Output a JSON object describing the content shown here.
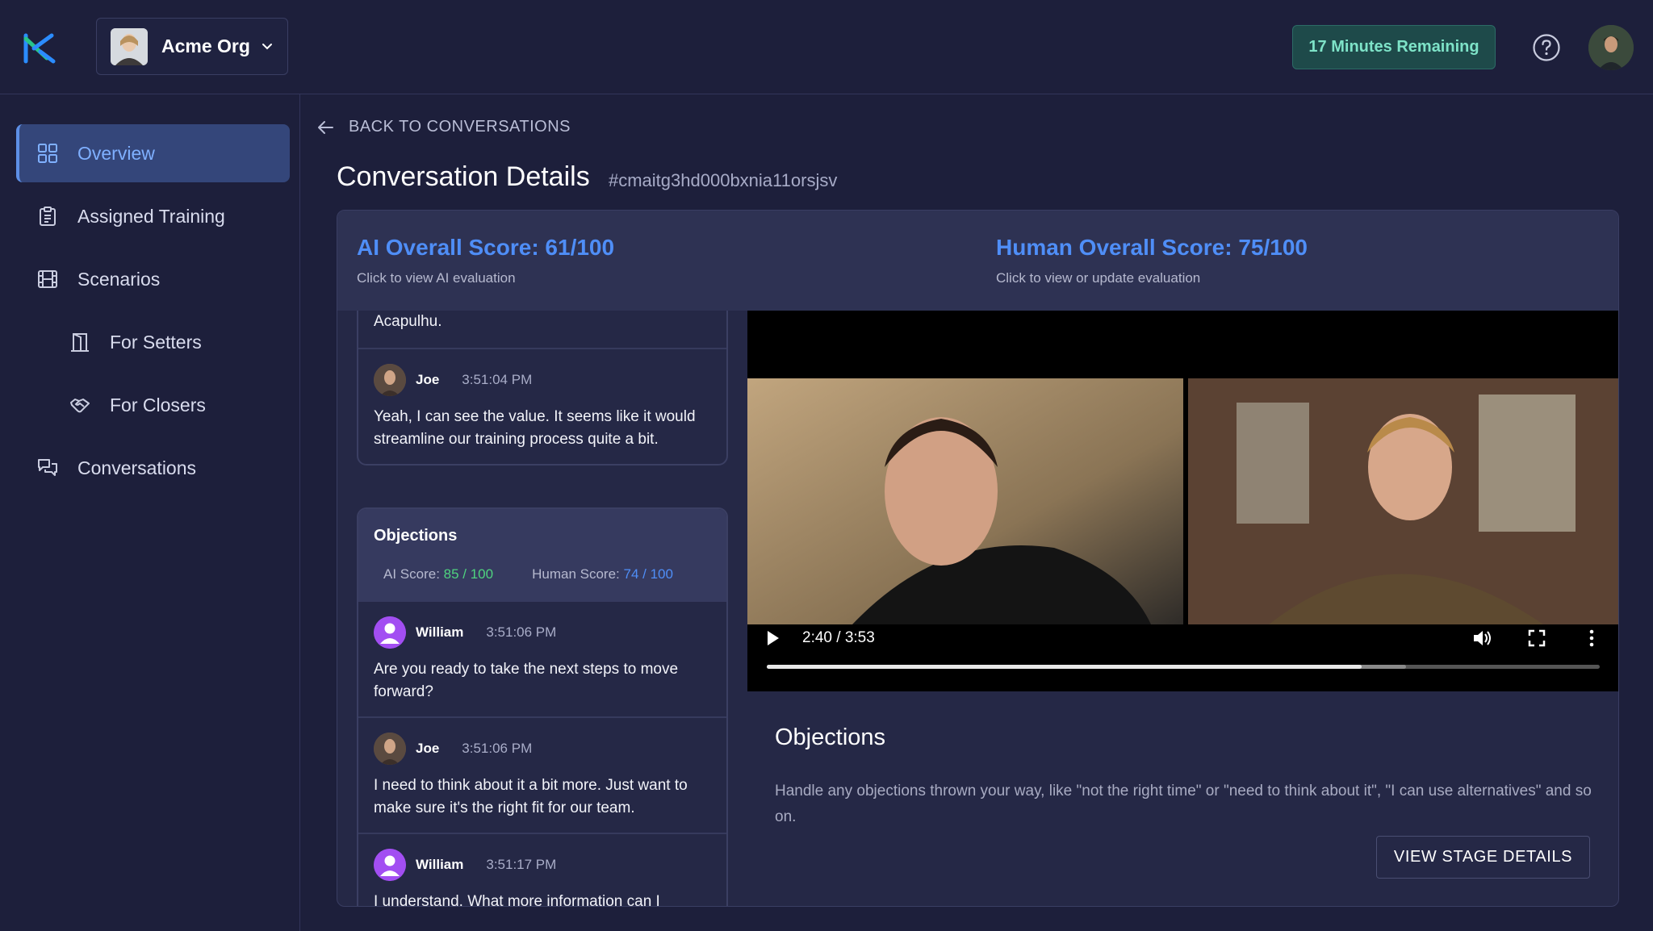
{
  "header": {
    "org_name": "Acme Org",
    "minutes_remaining": "17 Minutes Remaining"
  },
  "sidebar": {
    "items": [
      {
        "label": "Overview",
        "icon": "grid-icon",
        "active": true
      },
      {
        "label": "Assigned Training",
        "icon": "clipboard-icon"
      },
      {
        "label": "Scenarios",
        "icon": "film-icon"
      },
      {
        "label": "For Setters",
        "icon": "door-icon"
      },
      {
        "label": "For Closers",
        "icon": "handshake-icon"
      },
      {
        "label": "Conversations",
        "icon": "chat-bubbles-icon"
      }
    ]
  },
  "main": {
    "back_label": "BACK TO CONVERSATIONS",
    "title": "Conversation Details",
    "conversation_id": "#cmaitg3hd000bxnia11orsjsv",
    "ai_score_title": "AI Overall Score: 61/100",
    "ai_score_sub": "Click to view AI evaluation",
    "human_score_title": "Human Overall Score: 75/100",
    "human_score_sub": "Click to view or update evaluation"
  },
  "chat": {
    "truncated_text": "Acapulhu.",
    "msg1": {
      "name": "Joe",
      "time": "3:51:04 PM",
      "text": "Yeah, I can see the value. It seems like it would streamline our training process quite a bit."
    },
    "stage": {
      "title": "Objections",
      "ai_label": "AI Score: ",
      "ai_value": "85 / 100",
      "human_label": "Human Score: ",
      "human_value": "74 / 100"
    },
    "msg2": {
      "name": "William",
      "time": "3:51:06 PM",
      "text": "Are you ready to take the next steps to move forward?"
    },
    "msg3": {
      "name": "Joe",
      "time": "3:51:06 PM",
      "text": "I need to think about it a bit more. Just want to make sure it's the right fit for our team."
    },
    "msg4": {
      "name": "William",
      "time": "3:51:17 PM",
      "text": "I understand. What more information can I"
    }
  },
  "video": {
    "time": "2:40 / 3:53",
    "played_fraction": 0.7146,
    "buffered_fraction": 0.7674
  },
  "stage_detail": {
    "title": "Objections",
    "description": "Handle any objections thrown your way, like \"not the right time\" or \"need to think about it\", \"I can use alternatives\" and so on.",
    "button_label": "VIEW STAGE DETAILS"
  }
}
